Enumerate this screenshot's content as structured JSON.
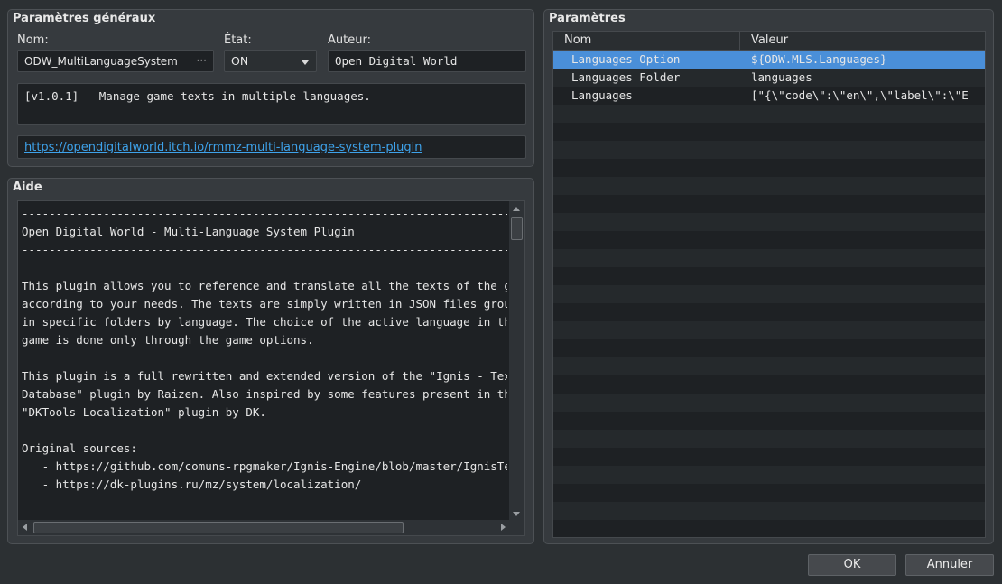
{
  "general": {
    "title": "Paramètres généraux",
    "name_label": "Nom:",
    "name_value": "ODW_MultiLanguageSystem",
    "name_button": "···",
    "state_label": "État:",
    "state_value": "ON",
    "author_label": "Auteur:",
    "author_value": "Open Digital World",
    "description": "[v1.0.1] - Manage game texts in multiple languages.",
    "url": "https://opendigitalworld.itch.io/rmmz-multi-language-system-plugin"
  },
  "help": {
    "title": "Aide",
    "lines": [
      "-------------------------------------------------------------------------------------------",
      "Open Digital World - Multi-Language System Plugin",
      "-------------------------------------------------------------------------------------------",
      "",
      "This plugin allows you to reference and translate all the texts of the game",
      "according to your needs. The texts are simply written in JSON files grouped",
      "in specific folders by language. The choice of the active language in the",
      "game is done only through the game options.",
      "",
      "This plugin is a full rewritten and extended version of the \"Ignis - Text",
      "Database\" plugin by Raizen. Also inspired by some features present in the",
      "\"DKTools Localization\" plugin by DK.",
      "",
      "Original sources:",
      "   - https://github.com/comuns-rpgmaker/Ignis-Engine/blob/master/IgnisTextDatabase",
      "   - https://dk-plugins.ru/mz/system/localization/",
      "",
      ""
    ]
  },
  "params": {
    "title": "Paramètres",
    "col_name": "Nom",
    "col_value": "Valeur",
    "rows": [
      {
        "name": "Languages Option",
        "value": "${ODW.MLS.Languages}",
        "selected": true
      },
      {
        "name": "Languages Folder",
        "value": "languages",
        "selected": false
      },
      {
        "name": "Languages",
        "value": "[\"{\\\"code\\\":\\\"en\\\",\\\"label\\\":\\\"E…",
        "selected": false
      }
    ]
  },
  "buttons": {
    "ok": "OK",
    "cancel": "Annuler"
  },
  "colors": {
    "selection": "#4a8fd9",
    "link": "#3ea2ea",
    "background": "#2c3033",
    "panel": "#363a3e"
  }
}
